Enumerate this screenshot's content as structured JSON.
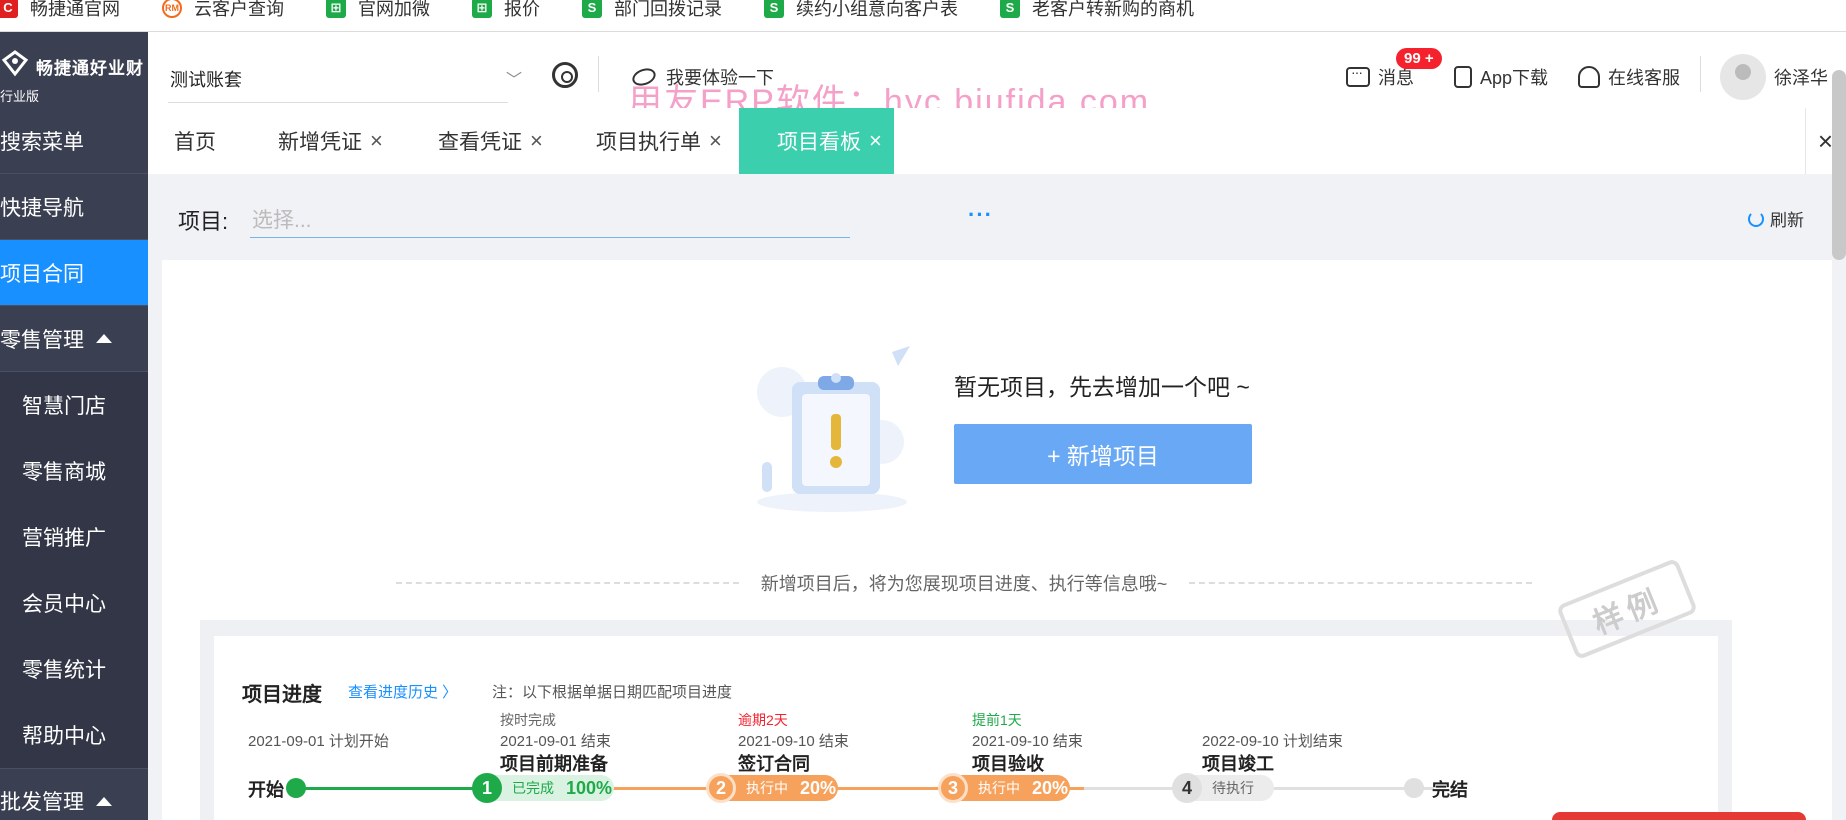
{
  "bookmarks": [
    {
      "label": "畅捷通官网",
      "icon": "red-c-icon",
      "icon_text": "C"
    },
    {
      "label": "云客户查询",
      "icon": "orange-circle-icon",
      "icon_text": "RM"
    },
    {
      "label": "官网加微",
      "icon": "green-sheet-icon",
      "icon_text": "⊞"
    },
    {
      "label": "报价",
      "icon": "green-sheet-icon",
      "icon_text": "⊞"
    },
    {
      "label": "部门回拨记录",
      "icon": "green-s-icon",
      "icon_text": "S"
    },
    {
      "label": "续约小组意向客户表",
      "icon": "green-s-icon",
      "icon_text": "S"
    },
    {
      "label": "老客户转新购的商机",
      "icon": "green-s-icon",
      "icon_text": "S"
    }
  ],
  "brand": {
    "name": "畅捷通好业财",
    "sub": "行业版"
  },
  "sidebar": {
    "items": [
      {
        "label": "搜索菜单"
      },
      {
        "label": "快捷导航"
      },
      {
        "label": "项目合同"
      },
      {
        "label": "零售管理"
      }
    ],
    "sub_items": [
      {
        "label": "智慧门店"
      },
      {
        "label": "零售商城"
      },
      {
        "label": "营销推广"
      },
      {
        "label": "会员中心"
      },
      {
        "label": "零售统计"
      },
      {
        "label": "帮助中心"
      }
    ],
    "bottom": {
      "label": "批发管理"
    }
  },
  "header": {
    "account": "测试账套",
    "try_label": "我要体验一下",
    "watermark": "用友ERP软件：hyc.bjufida.com",
    "messages_label": "消息",
    "messages_badge": "99 +",
    "app_label": "App下载",
    "service_label": "在线客服",
    "user_name": "徐泽华"
  },
  "tabs": [
    {
      "label": "首页"
    },
    {
      "label": "新增凭证",
      "close": "×"
    },
    {
      "label": "查看凭证",
      "close": "×"
    },
    {
      "label": "项目执行单",
      "close": "×"
    },
    {
      "label": "项目看板",
      "close": "×",
      "active": true
    }
  ],
  "tabs_close_all": "×",
  "filter": {
    "label": "项目:",
    "placeholder": "选择...",
    "more": "···",
    "refresh": "刷新"
  },
  "empty": {
    "message": "暂无项目，先去增加一个吧 ~",
    "add_button": "+ 新增项目",
    "info": "新增项目后，将为您展现项目进度、执行等信息哦~",
    "stamp": "样例"
  },
  "progress": {
    "title": "项目进度",
    "history_link": "查看进度历史 〉",
    "note": "注：以下根据单据日期匹配项目进度",
    "start": {
      "date": "2021-09-01 计划开始",
      "name": "开始"
    },
    "stages": [
      {
        "status_top": "按时完成",
        "date": "2021-09-01 结束",
        "name": "项目前期准备",
        "num": "1",
        "state": "已完成",
        "pct": "100%",
        "color": "#1faa4a"
      },
      {
        "status_top": "逾期2天",
        "date": "2021-09-10 结束",
        "name": "签订合同",
        "num": "2",
        "state": "执行中",
        "pct": "20%",
        "color": "#f5222d"
      },
      {
        "status_top": "提前1天",
        "date": "2021-09-10 结束",
        "name": "项目验收",
        "num": "3",
        "state": "执行中",
        "pct": "20%",
        "color": "#1faa4a"
      },
      {
        "status_top": "",
        "date": "2022-09-10 计划结束",
        "name": "项目竣工",
        "num": "4",
        "state": "待执行",
        "pct": "",
        "color": "#999"
      }
    ],
    "end": {
      "name": "完结"
    }
  },
  "colors": {
    "sidebar": "#3a3f51",
    "active_nav": "#1890ff",
    "active_tab": "#3ccfae",
    "primary_button": "#69a8f4"
  }
}
